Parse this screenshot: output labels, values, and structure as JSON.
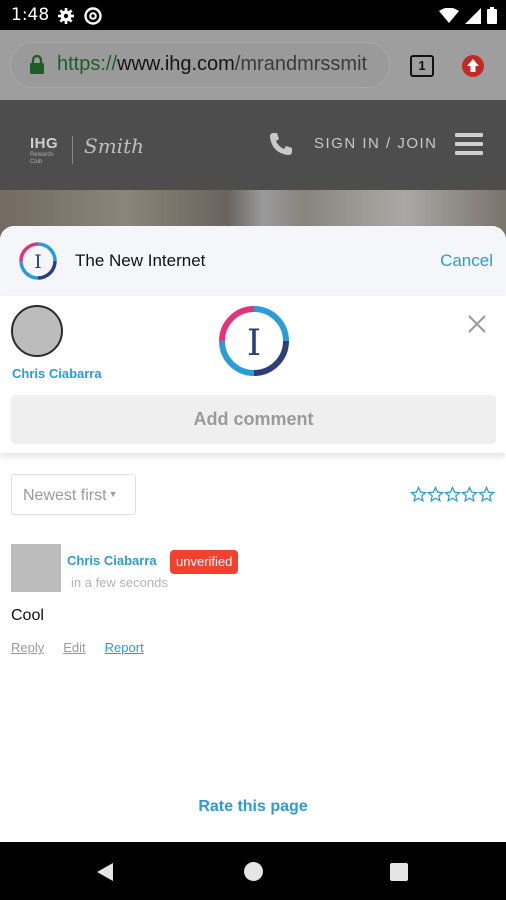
{
  "status_bar": {
    "time": "1:48"
  },
  "browser": {
    "url_scheme": "https://",
    "url_host": "www.ihg.com",
    "url_path": "/mrandmrssmit",
    "tab_count": "1"
  },
  "site": {
    "ihg_brand": "IHG",
    "ihg_sub1": "Rewards",
    "ihg_sub2": "Club",
    "smith_brand": "Smith",
    "sign_in_label": "SIGN IN / JOIN"
  },
  "sheet": {
    "title": "The New Internet",
    "cancel_label": "Cancel",
    "user_name": "Chris Ciabarra",
    "add_comment_label": "Add comment",
    "sort_label": "Newest first",
    "rating_stars": 5,
    "rating_value": 0
  },
  "comments": [
    {
      "author": "Chris Ciabarra",
      "badge": "unverified",
      "time": "in a few seconds",
      "body": "Cool",
      "actions": {
        "reply": "Reply",
        "edit": "Edit",
        "report": "Report"
      }
    }
  ],
  "footer": {
    "rate_label": "Rate this page"
  },
  "colors": {
    "accent": "#2a9cd8",
    "badge": "#f2412f"
  }
}
